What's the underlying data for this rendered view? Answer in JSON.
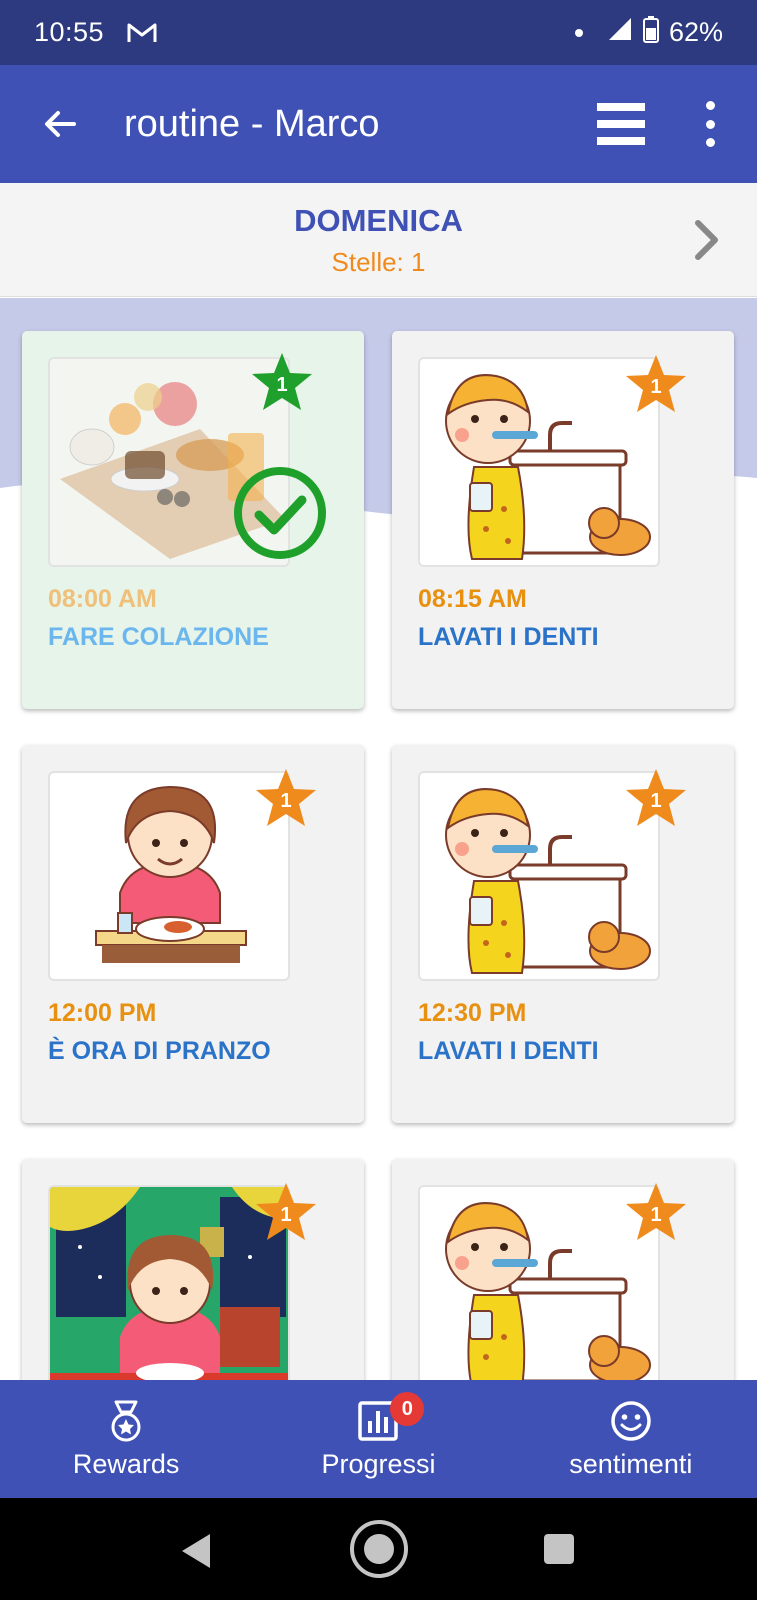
{
  "status_bar": {
    "time": "10:55",
    "battery": "62%",
    "icons": [
      "gmail-icon",
      "signal-icon",
      "battery-icon"
    ]
  },
  "app_bar": {
    "title": "routine - Marco",
    "icons": [
      "back-arrow-icon",
      "menu-icon",
      "more-vert-icon"
    ]
  },
  "day": {
    "name": "DOMENICA",
    "stars": "Stelle: 1",
    "next_icon": "chevron-right-icon"
  },
  "tasks": [
    {
      "time": "08:00 AM",
      "label": "FARE COLAZIONE",
      "stars": "1",
      "done": true,
      "image": "breakfast-image"
    },
    {
      "time": "08:15 AM",
      "label": "LAVATI I DENTI",
      "stars": "1",
      "done": false,
      "image": "brush-teeth-image"
    },
    {
      "time": "12:00 PM",
      "label": "È ORA DI PRANZO",
      "stars": "1",
      "done": false,
      "image": "lunch-image"
    },
    {
      "time": "12:30 PM",
      "label": "LAVATI I DENTI",
      "stars": "1",
      "done": false,
      "image": "brush-teeth-image"
    },
    {
      "time": "",
      "label": "",
      "stars": "1",
      "done": false,
      "image": "dinner-image"
    },
    {
      "time": "",
      "label": "",
      "stars": "1",
      "done": false,
      "image": "brush-teeth-image"
    }
  ],
  "bottom_nav": {
    "items": [
      {
        "label": "Rewards",
        "icon": "medal-icon"
      },
      {
        "label": "Progressi",
        "icon": "chart-icon",
        "badge": "0"
      },
      {
        "label": "sentimenti",
        "icon": "smiley-icon"
      }
    ]
  },
  "colors": {
    "primary": "#3f51b5",
    "status_bar": "#2e3a7f",
    "accent_orange": "#ef8b1c",
    "done_green": "#1fa02b",
    "time_color": "#e8900f",
    "label_color": "#2a73c9"
  }
}
